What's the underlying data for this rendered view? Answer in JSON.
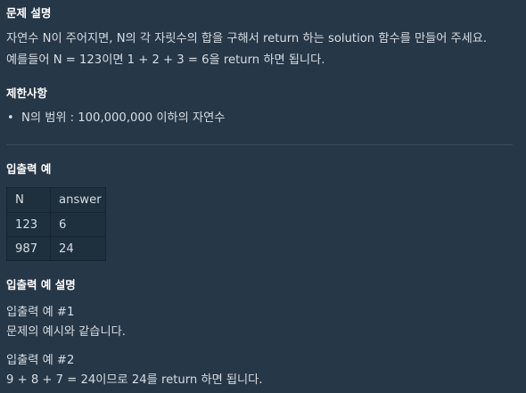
{
  "problem": {
    "heading": "문제 설명",
    "line1": "자연수 N이 주어지면, N의 각 자릿수의 합을 구해서 return 하는 solution 함수를 만들어 주세요.",
    "line2": "예를들어 N = 123이면 1 + 2 + 3 = 6을 return 하면 됩니다."
  },
  "constraints": {
    "heading": "제한사항",
    "items": [
      "N의 범위 : 100,000,000 이하의 자연수"
    ]
  },
  "examples": {
    "heading": "입출력 예",
    "columns": [
      "N",
      "answer"
    ],
    "rows": [
      [
        "123",
        "6"
      ],
      [
        "987",
        "24"
      ]
    ]
  },
  "explanation": {
    "heading": "입출력 예 설명",
    "ex1_title": "입출력 예 #1",
    "ex1_text": "문제의 예시와 같습니다.",
    "ex2_title": "입출력 예 #2",
    "ex2_text": "9 + 8 + 7 = 24이므로 24를 return 하면 됩니다."
  }
}
